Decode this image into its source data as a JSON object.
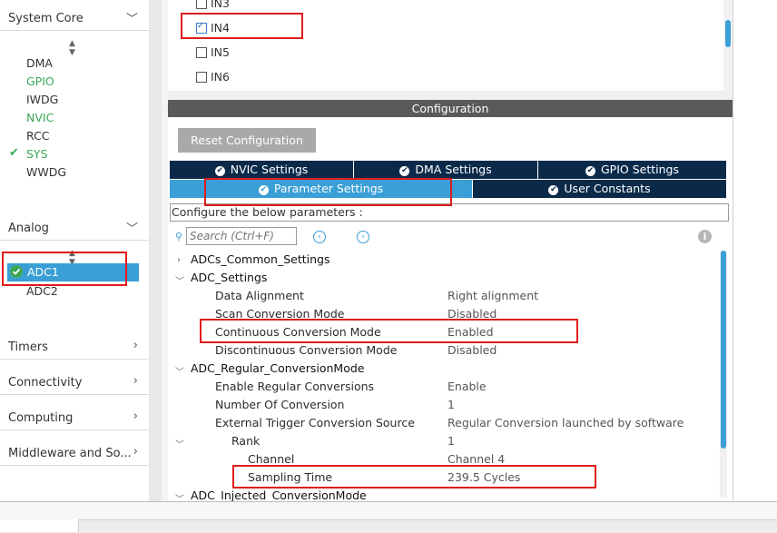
{
  "sidebar": {
    "system_core": {
      "label": "System Core",
      "items": [
        {
          "label": "DMA",
          "status": "default"
        },
        {
          "label": "GPIO",
          "status": "configured"
        },
        {
          "label": "IWDG",
          "status": "default"
        },
        {
          "label": "NVIC",
          "status": "configured"
        },
        {
          "label": "RCC",
          "status": "default"
        },
        {
          "label": "SYS",
          "status": "ok"
        },
        {
          "label": "WWDG",
          "status": "default"
        }
      ]
    },
    "analog": {
      "label": "Analog",
      "items": [
        {
          "label": "ADC1",
          "status": "selected-ok"
        },
        {
          "label": "ADC2",
          "status": "default"
        }
      ]
    },
    "timers": {
      "label": "Timers"
    },
    "connectivity": {
      "label": "Connectivity"
    },
    "computing": {
      "label": "Computing"
    },
    "middleware": {
      "label": "Middleware and So..."
    }
  },
  "channels": [
    {
      "label": "IN3",
      "checked": false
    },
    {
      "label": "IN4",
      "checked": true
    },
    {
      "label": "IN5",
      "checked": false
    },
    {
      "label": "IN6",
      "checked": false
    }
  ],
  "config": {
    "header": "Configuration",
    "reset_button": "Reset Configuration",
    "tabs_row1": [
      "NVIC Settings",
      "DMA Settings",
      "GPIO Settings"
    ],
    "tabs_row2": [
      "Parameter Settings",
      "User Constants"
    ],
    "active_tab": "Parameter Settings",
    "instructions": "Configure the below parameters :",
    "search_placeholder": "Search (Ctrl+F)"
  },
  "tree": {
    "adcs_common": "ADCs_Common_Settings",
    "adc_settings": "ADC_Settings",
    "data_alignment": {
      "label": "Data Alignment",
      "value": "Right alignment"
    },
    "scan_mode": {
      "label": "Scan Conversion Mode",
      "value": "Disabled"
    },
    "continuous_mode": {
      "label": "Continuous Conversion Mode",
      "value": "Enabled"
    },
    "discontinuous_mode": {
      "label": "Discontinuous Conversion Mode",
      "value": "Disabled"
    },
    "regular_group": "ADC_Regular_ConversionMode",
    "enable_regular": {
      "label": "Enable Regular Conversions",
      "value": "Enable"
    },
    "num_conversion": {
      "label": "Number Of Conversion",
      "value": "1"
    },
    "ext_trigger": {
      "label": "External Trigger Conversion Source",
      "value": "Regular Conversion launched by software"
    },
    "rank": {
      "label": "Rank",
      "value": "1"
    },
    "channel": {
      "label": "Channel",
      "value": "Channel 4"
    },
    "sampling_time": {
      "label": "Sampling Time",
      "value": "239.5 Cycles"
    },
    "injected_group": "ADC_Injected_ConversionMode"
  },
  "colors": {
    "accent_blue": "#3a9fd6",
    "tab_dark": "#0b2a4a",
    "highlight_red": "#e01b1b",
    "status_green": "#3aa655"
  }
}
